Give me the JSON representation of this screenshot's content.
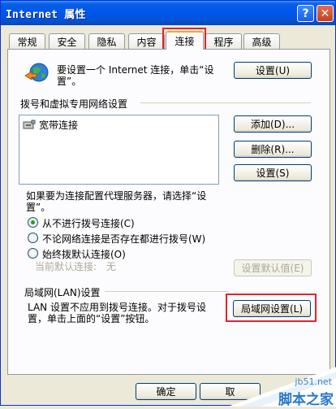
{
  "window": {
    "title": "Internet 属性"
  },
  "titlebar_buttons": {
    "help": "?",
    "close": "✕"
  },
  "tabs": [
    {
      "label": "常规"
    },
    {
      "label": "安全"
    },
    {
      "label": "隐私"
    },
    {
      "label": "内容"
    },
    {
      "label": "连接"
    },
    {
      "label": "程序"
    },
    {
      "label": "高级"
    }
  ],
  "setup": {
    "text_line1": "要设置一个 Internet 连接，单击“设",
    "text_line2": "置”。",
    "button": "设置(U)"
  },
  "dialup": {
    "group_label": "拨号和虚拟专用网络设置",
    "connections": [
      "宽带连接"
    ],
    "add_button": "添加(D)...",
    "remove_button": "删除(R)...",
    "settings_button": "设置(S)"
  },
  "proxy_note": {
    "line1": "如果要为连接配置代理服务器，请选择“设",
    "line2": "置”。"
  },
  "dial_options": [
    {
      "label": "从不进行拨号连接(C)",
      "checked": true
    },
    {
      "label": "不论网络连接是否存在都进行拨号(W)",
      "checked": false
    },
    {
      "label": "始终拨默认连接(O)",
      "checked": false
    }
  ],
  "default_connection": {
    "label": "当前默认连接:",
    "value": "无",
    "button": "设置默认值(E)"
  },
  "lan": {
    "group_label": "局域网(LAN)设置",
    "text_line1": "LAN 设置不应用到拨号连接。对于拨号设",
    "text_line2": "置，单击上面的“设置”按钮。",
    "button": "局域网设置(L)"
  },
  "footer": {
    "ok": "确定",
    "cancel": "取"
  },
  "watermark": {
    "line1": "jb51.net",
    "line2": "脚本之家"
  },
  "colors": {
    "title_blue": "#0058ee",
    "highlight_red": "#e5222c",
    "tab_accent": "#f3a53a"
  }
}
